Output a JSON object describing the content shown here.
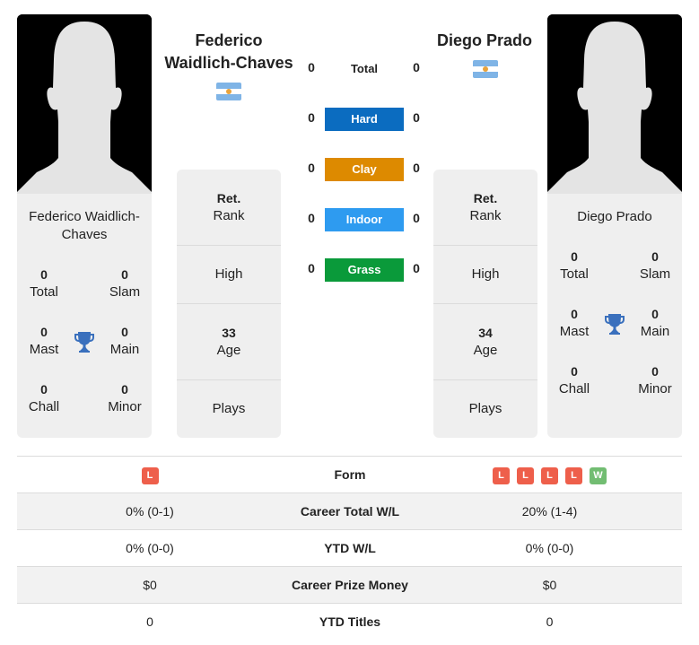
{
  "colors": {
    "hard": "#0b6cc0",
    "clay": "#dd8a00",
    "indoor": "#2e9bf0",
    "grass": "#0a9a3a",
    "loss": "#ee5f4b",
    "win": "#72bd72",
    "trophy": "#3a70bd"
  },
  "player1": {
    "name": "Federico Waidlich-Chaves",
    "header_name_line1": "Federico",
    "header_name_line2": "Waidlich-Chaves",
    "card_name_line1": "Federico Waidlich-",
    "card_name_line2": "Chaves",
    "flag": "argentina-flag",
    "titles": {
      "total": {
        "value": "0",
        "label": "Total"
      },
      "slam": {
        "value": "0",
        "label": "Slam"
      },
      "mast": {
        "value": "0",
        "label": "Mast"
      },
      "main": {
        "value": "0",
        "label": "Main"
      },
      "chall": {
        "value": "0",
        "label": "Chall"
      },
      "minor": {
        "value": "0",
        "label": "Minor"
      }
    },
    "rank": {
      "value": "Ret.",
      "label": "Rank"
    },
    "high": {
      "label": "High"
    },
    "age": {
      "value": "33",
      "label": "Age"
    },
    "plays": {
      "label": "Plays"
    }
  },
  "player2": {
    "name": "Diego Prado",
    "card_name": "Diego Prado",
    "flag": "argentina-flag",
    "titles": {
      "total": {
        "value": "0",
        "label": "Total"
      },
      "slam": {
        "value": "0",
        "label": "Slam"
      },
      "mast": {
        "value": "0",
        "label": "Mast"
      },
      "main": {
        "value": "0",
        "label": "Main"
      },
      "chall": {
        "value": "0",
        "label": "Chall"
      },
      "minor": {
        "value": "0",
        "label": "Minor"
      }
    },
    "rank": {
      "value": "Ret.",
      "label": "Rank"
    },
    "high": {
      "label": "High"
    },
    "age": {
      "value": "34",
      "label": "Age"
    },
    "plays": {
      "label": "Plays"
    }
  },
  "h2h": {
    "total": {
      "label": "Total",
      "p1": "0",
      "p2": "0"
    },
    "surfaces": [
      {
        "label": "Hard",
        "p1": "0",
        "p2": "0"
      },
      {
        "label": "Clay",
        "p1": "0",
        "p2": "0"
      },
      {
        "label": "Indoor",
        "p1": "0",
        "p2": "0"
      },
      {
        "label": "Grass",
        "p1": "0",
        "p2": "0"
      }
    ]
  },
  "comparison": {
    "form": {
      "label": "Form",
      "p1": [
        "L"
      ],
      "p2": [
        "L",
        "L",
        "L",
        "L",
        "W"
      ]
    },
    "rows": [
      {
        "label": "Career Total W/L",
        "p1": "0% (0-1)",
        "p2": "20% (1-4)"
      },
      {
        "label": "YTD W/L",
        "p1": "0% (0-0)",
        "p2": "0% (0-0)"
      },
      {
        "label": "Career Prize Money",
        "p1": "$0",
        "p2": "$0"
      },
      {
        "label": "YTD Titles",
        "p1": "0",
        "p2": "0"
      }
    ]
  }
}
